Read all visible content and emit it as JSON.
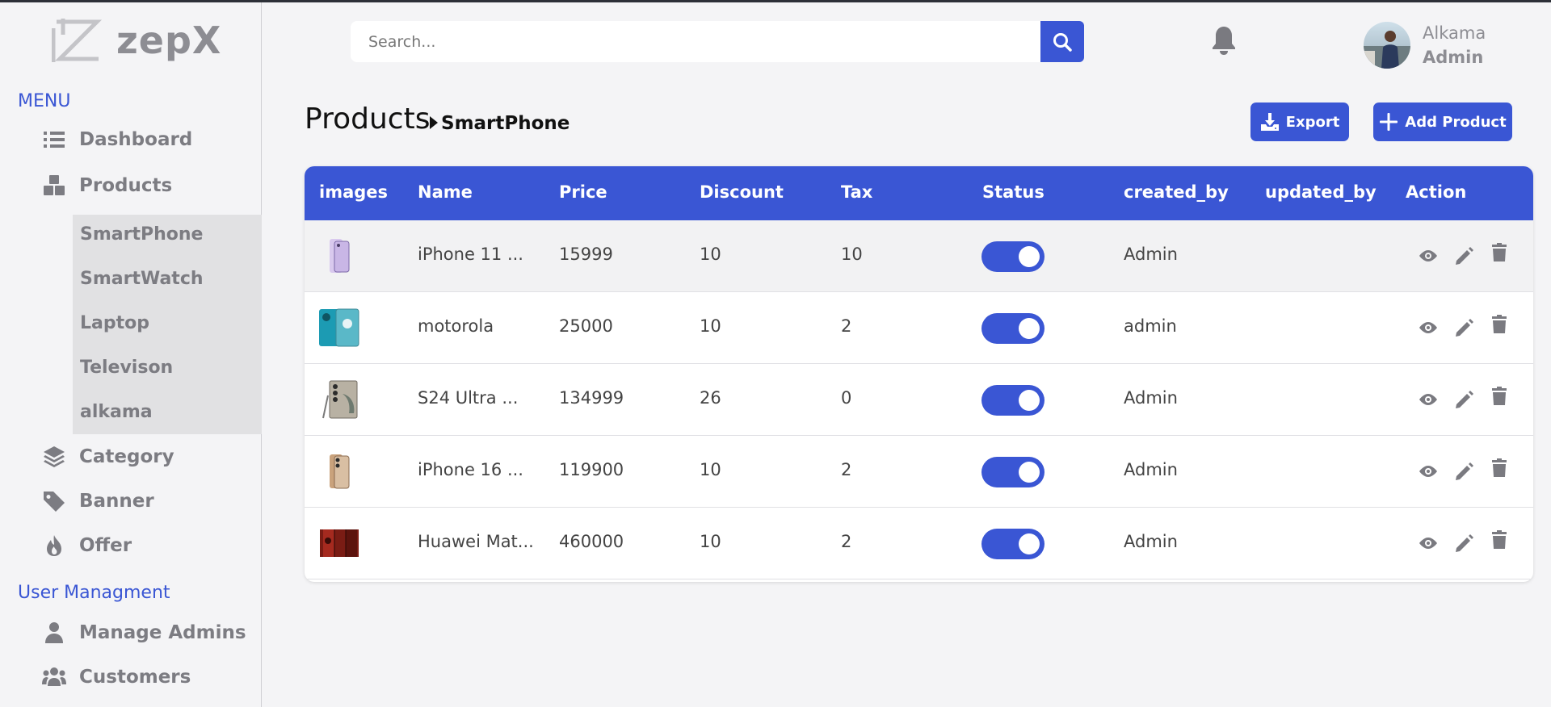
{
  "brand": {
    "name": "zepX"
  },
  "sidebar": {
    "menu_title": "MENU",
    "items": [
      {
        "label": "Dashboard",
        "icon": "list-icon"
      },
      {
        "label": "Products",
        "icon": "boxes-icon"
      },
      {
        "label": "Category",
        "icon": "layers-icon"
      },
      {
        "label": "Banner",
        "icon": "tag-icon"
      },
      {
        "label": "Offer",
        "icon": "fire-icon"
      }
    ],
    "product_subitems": [
      "SmartPhone",
      "SmartWatch",
      "Laptop",
      "Televison",
      "alkama"
    ],
    "user_section_title": "User Managment",
    "user_items": [
      {
        "label": "Manage Admins",
        "icon": "user-icon"
      },
      {
        "label": "Customers",
        "icon": "users-icon"
      }
    ]
  },
  "header": {
    "search_placeholder": "Search...",
    "user_name": "Alkama",
    "user_role": "Admin"
  },
  "page": {
    "title": "Products",
    "breadcrumb": "SmartPhone",
    "export_label": "Export",
    "add_label": "Add Product"
  },
  "table": {
    "columns": [
      "images",
      "Name",
      "Price",
      "Discount",
      "Tax",
      "Status",
      "created_by",
      "updated_by",
      "Action"
    ],
    "rows": [
      {
        "name": "iPhone 11 ...",
        "price": "15999",
        "discount": "10",
        "tax": "10",
        "status": true,
        "created_by": "Admin",
        "updated_by": ""
      },
      {
        "name": "motorola",
        "price": "25000",
        "discount": "10",
        "tax": "2",
        "status": true,
        "created_by": "admin",
        "updated_by": ""
      },
      {
        "name": "S24 Ultra ...",
        "price": "134999",
        "discount": "26",
        "tax": "0",
        "status": true,
        "created_by": "Admin",
        "updated_by": ""
      },
      {
        "name": "iPhone 16 ...",
        "price": "119900",
        "discount": "10",
        "tax": "2",
        "status": true,
        "created_by": "Admin",
        "updated_by": ""
      },
      {
        "name": "Huawei Mat...",
        "price": "460000",
        "discount": "10",
        "tax": "2",
        "status": true,
        "created_by": "Admin",
        "updated_by": ""
      }
    ]
  },
  "colors": {
    "accent": "#3a56d4",
    "muted": "#7c7c82",
    "background": "#f4f4f6"
  }
}
